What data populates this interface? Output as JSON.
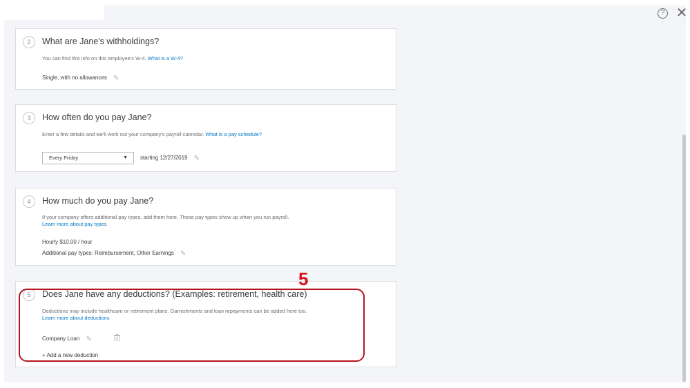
{
  "header": {
    "help_icon": "question-circle-icon",
    "help_glyph": "?",
    "close_icon": "close-icon",
    "close_glyph": "✕"
  },
  "sections": [
    {
      "step": "2",
      "title": "What are Jane's withholdings?",
      "description": "You can find this info on this employee's W-4.",
      "link": "What is a W-4?",
      "value": "Single, with no allowances"
    },
    {
      "step": "3",
      "title": "How often do you pay Jane?",
      "description": "Enter a few details and we'll work out your company's payroll calendar.",
      "link": "What is a pay schedule?",
      "select_value": "Every Friday",
      "starting": "starting 12/27/2019"
    },
    {
      "step": "4",
      "title": "How much do you pay Jane?",
      "description": "If your company offers additional pay types, add them here. These pay types show up when you run payroll.",
      "link": "Learn more about pay types",
      "rate": "Hourly $10.00 / hour",
      "additional": "Additional pay types: Reimbursement, Other Earnings"
    },
    {
      "step": "5",
      "title": "Does Jane have any deductions? (Examples: retirement, health care)",
      "description": "Deductions may include healthcare or retirement plans. Garnishments and loan repayments can be added here too.",
      "link": "Learn more about deductions",
      "deduction": "Company Loan",
      "add_link": "+ Add a new deduction"
    }
  ],
  "annotation": {
    "number": "5",
    "color": "#d8141a"
  },
  "colors": {
    "link": "#0077c5",
    "text": "#393a3d",
    "muted": "#6b6c72",
    "annotation": "#b3141a"
  }
}
